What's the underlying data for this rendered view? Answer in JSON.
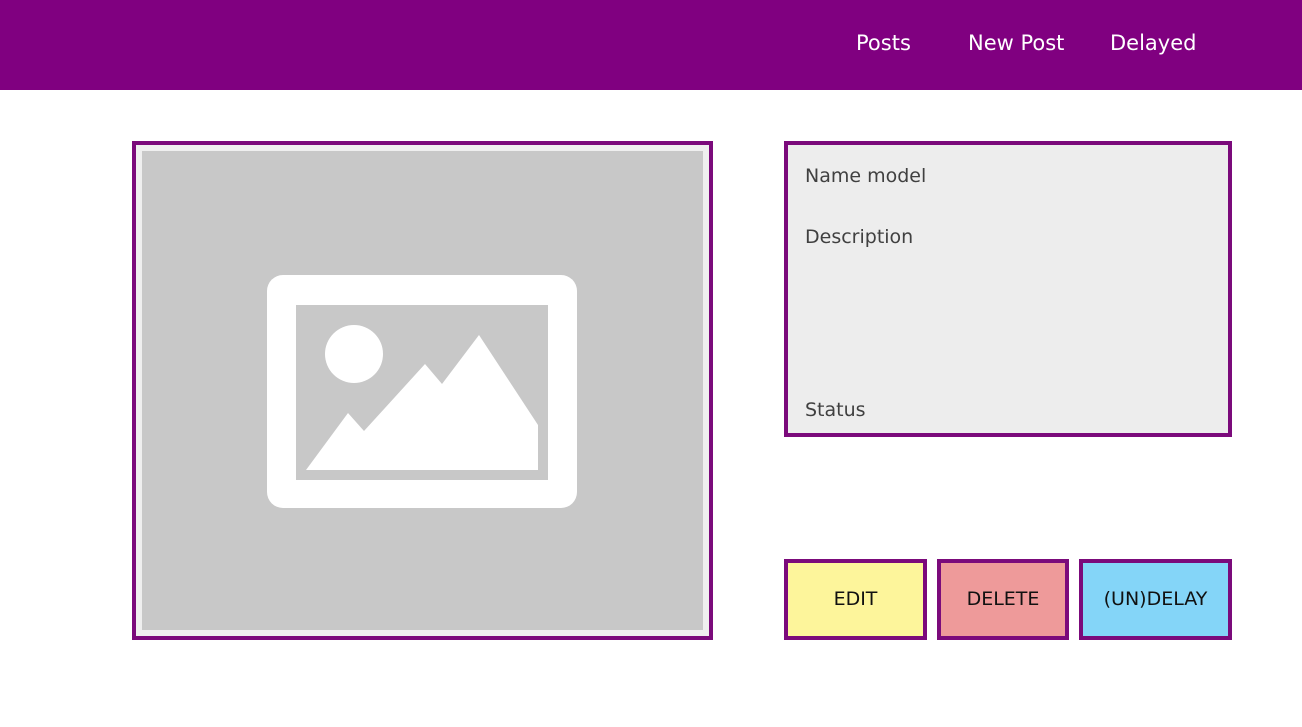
{
  "nav": {
    "links": [
      {
        "label": "Posts"
      },
      {
        "label": "New Post"
      },
      {
        "label": "Delayed"
      }
    ]
  },
  "post": {
    "image_icon": "image-placeholder-icon",
    "name_label": "Name model",
    "description_label": "Description",
    "status_label": "Status"
  },
  "actions": {
    "edit_label": "EDIT",
    "delete_label": "DELETE",
    "undelay_label": "(UN)DELAY"
  },
  "colors": {
    "brand": "#800080",
    "border": "#7b0a7b",
    "edit": "#fdf59b",
    "delete": "#ee9a9a",
    "undelay": "#84d5f8"
  }
}
